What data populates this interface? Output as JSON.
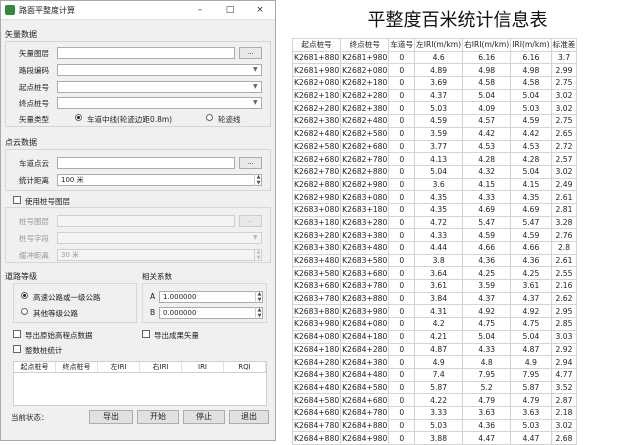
{
  "window": {
    "title": "路面平整度计算",
    "min": "–",
    "max": "□",
    "close": "×"
  },
  "vector": {
    "section": "矢量数据",
    "layer_label": "矢量图层",
    "browse": "...",
    "road_label": "路段编码",
    "start_label": "起点桩号",
    "end_label": "终点桩号",
    "type_label": "矢量类型",
    "opt_center": "车道中线(轮迹边距0.8m)",
    "opt_wheel": "轮迹线"
  },
  "cloud": {
    "section": "点云数据",
    "cloud_label": "车道点云",
    "dist_label": "统计距离",
    "dist_value": "100 米",
    "use_chain": "使用桩号图层",
    "chain_layer": "桩号图层",
    "chain_field": "桩号字段",
    "buffer_label": "缓冲距离",
    "buffer_value": "30 米"
  },
  "road_level": {
    "section": "道路等级",
    "opt1": "高速公路或一级公路",
    "opt2": "其他等级公路"
  },
  "coef": {
    "section": "相关系数",
    "a_label": "A",
    "a_value": "1.000000",
    "b_label": "B",
    "b_value": "0.000000"
  },
  "export_elev": "导出原始高程点数据",
  "export_vec": "导出成果矢量",
  "whole_stats": "整数桩统计",
  "list_headers": [
    "起点桩号",
    "终点桩号",
    "左IRI",
    "右IRI",
    "IRI",
    "RQI"
  ],
  "status": "当前状态：",
  "buttons": {
    "export": "导出",
    "start": "开始",
    "stop": "停止",
    "exit": "退出"
  },
  "table": {
    "title": "平整度百米统计信息表",
    "headers": [
      "起点桩号",
      "终点桩号",
      "车道号",
      "左IRI(m/km)",
      "右IRI(m/km)",
      "IRI(m/km)",
      "标准差"
    ],
    "rows": [
      [
        "K2681+880",
        "K2681+980",
        "0",
        "4.6",
        "6.16",
        "6.16",
        "3.7"
      ],
      [
        "K2681+980",
        "K2682+080",
        "0",
        "4.89",
        "4.98",
        "4.98",
        "2.99"
      ],
      [
        "K2682+080",
        "K2682+180",
        "0",
        "3.69",
        "4.58",
        "4.58",
        "2.75"
      ],
      [
        "K2682+180",
        "K2682+280",
        "0",
        "4.37",
        "5.04",
        "5.04",
        "3.02"
      ],
      [
        "K2682+280",
        "K2682+380",
        "0",
        "5.03",
        "4.09",
        "5.03",
        "3.02"
      ],
      [
        "K2682+380",
        "K2682+480",
        "0",
        "4.59",
        "4.57",
        "4.59",
        "2.75"
      ],
      [
        "K2682+480",
        "K2682+580",
        "0",
        "3.59",
        "4.42",
        "4.42",
        "2.65"
      ],
      [
        "K2682+580",
        "K2682+680",
        "0",
        "3.77",
        "4.53",
        "4.53",
        "2.72"
      ],
      [
        "K2682+680",
        "K2682+780",
        "0",
        "4.13",
        "4.28",
        "4.28",
        "2.57"
      ],
      [
        "K2682+780",
        "K2682+880",
        "0",
        "5.04",
        "4.32",
        "5.04",
        "3.02"
      ],
      [
        "K2682+880",
        "K2682+980",
        "0",
        "3.6",
        "4.15",
        "4.15",
        "2.49"
      ],
      [
        "K2682+980",
        "K2683+080",
        "0",
        "4.35",
        "4.33",
        "4.35",
        "2.61"
      ],
      [
        "K2683+080",
        "K2683+180",
        "0",
        "4.35",
        "4.69",
        "4.69",
        "2.81"
      ],
      [
        "K2683+180",
        "K2683+280",
        "0",
        "4.72",
        "5.47",
        "5.47",
        "3.28"
      ],
      [
        "K2683+280",
        "K2683+380",
        "0",
        "4.33",
        "4.59",
        "4.59",
        "2.76"
      ],
      [
        "K2683+380",
        "K2683+480",
        "0",
        "4.44",
        "4.66",
        "4.66",
        "2.8"
      ],
      [
        "K2683+480",
        "K2683+580",
        "0",
        "3.8",
        "4.36",
        "4.36",
        "2.61"
      ],
      [
        "K2683+580",
        "K2683+680",
        "0",
        "3.64",
        "4.25",
        "4.25",
        "2.55"
      ],
      [
        "K2683+680",
        "K2683+780",
        "0",
        "3.61",
        "3.59",
        "3.61",
        "2.16"
      ],
      [
        "K2683+780",
        "K2683+880",
        "0",
        "3.84",
        "4.37",
        "4.37",
        "2.62"
      ],
      [
        "K2683+880",
        "K2683+980",
        "0",
        "4.31",
        "4.92",
        "4.92",
        "2.95"
      ],
      [
        "K2683+980",
        "K2684+080",
        "0",
        "4.2",
        "4.75",
        "4.75",
        "2.85"
      ],
      [
        "K2684+080",
        "K2684+180",
        "0",
        "4.21",
        "5.04",
        "5.04",
        "3.03"
      ],
      [
        "K2684+180",
        "K2684+280",
        "0",
        "4.87",
        "4.33",
        "4.87",
        "2.92"
      ],
      [
        "K2684+280",
        "K2684+380",
        "0",
        "4.9",
        "4.8",
        "4.9",
        "2.94"
      ],
      [
        "K2684+380",
        "K2684+480",
        "0",
        "7.4",
        "7.95",
        "7.95",
        "4.77"
      ],
      [
        "K2684+480",
        "K2684+580",
        "0",
        "5.87",
        "5.2",
        "5.87",
        "3.52"
      ],
      [
        "K2684+580",
        "K2684+680",
        "0",
        "4.22",
        "4.79",
        "4.79",
        "2.87"
      ],
      [
        "K2684+680",
        "K2684+780",
        "0",
        "3.33",
        "3.63",
        "3.63",
        "2.18"
      ],
      [
        "K2684+780",
        "K2684+880",
        "0",
        "5.03",
        "4.36",
        "5.03",
        "3.02"
      ],
      [
        "K2684+880",
        "K2684+980",
        "0",
        "3.88",
        "4.47",
        "4.47",
        "2.68"
      ]
    ]
  }
}
